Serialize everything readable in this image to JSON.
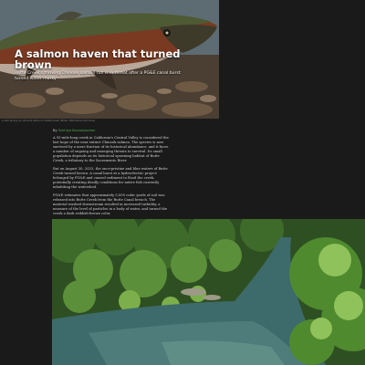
{
  "hero": {
    "title": "A salmon haven that turned brown",
    "dek": "Butte Creek's thriving Chinook salmon run is in threat after a PG&E canal burst turned water murky",
    "image_icon": "salmon-photo"
  },
  "credit": {
    "text": "A wild spring-run Chinook salmon in Butte Creek (Photo: Wikimedia Commons)"
  },
  "byline": {
    "prefix": "By",
    "author": "Sukhiya Kausalyaphan"
  },
  "article": {
    "paragraphs": [
      "A 93-mile-long creek in California's Central Valley is considered the last hope of the near extinct Chinook salmon. The species is now survived by a mere fraction of its historical abundance, and it faces a number of ongoing and emerging threats to survival. Its small population depends on its historical spawning habitat of Butte Creek, a tributary to the Sacramento River.",
      "But on August 30, 2023, the once-pristine and blue waters of Butte Creek turned brown. A canal burst at a hydroelectric project belonged by PG&E and caused sediment to flood the creek, potentially creating deadly conditions for native fish currently inhabiting the watershed.",
      "PG&E estimates that approximately 5,000 cubic yards of soil was released into Butte Creek from the Butte Canal breach. The material washed downstream resulted in increased turbidity, a measure of the level of particles in a body of water, and turned the creek a dark reddish-brown color."
    ],
    "river_image_icon": "river-photo"
  }
}
